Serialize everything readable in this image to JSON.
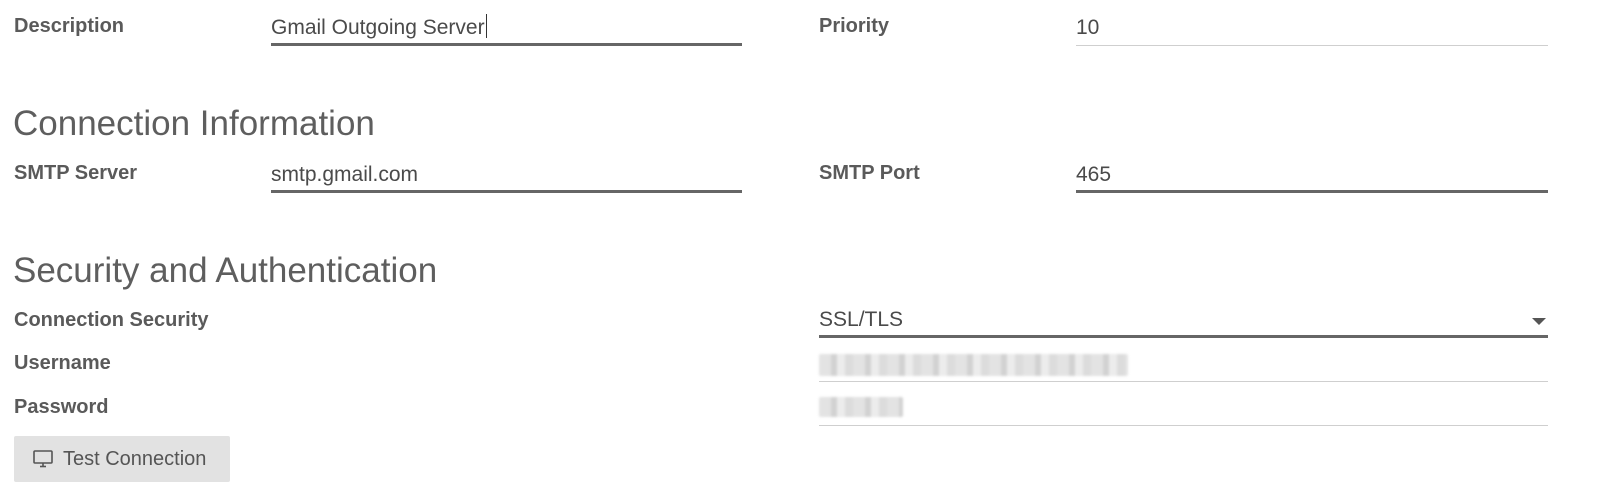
{
  "general": {
    "description_label": "Description",
    "description_value": "Gmail Outgoing Server",
    "priority_label": "Priority",
    "priority_value": "10"
  },
  "connection": {
    "section_title": "Connection Information",
    "smtp_server_label": "SMTP Server",
    "smtp_server_value": "smtp.gmail.com",
    "smtp_port_label": "SMTP Port",
    "smtp_port_value": "465"
  },
  "security": {
    "section_title": "Security and Authentication",
    "connection_security_label": "Connection Security",
    "connection_security_value": "SSL/TLS",
    "username_label": "Username",
    "password_label": "Password"
  },
  "actions": {
    "test_connection_label": "Test Connection",
    "test_connection_icon": "monitor-icon"
  }
}
